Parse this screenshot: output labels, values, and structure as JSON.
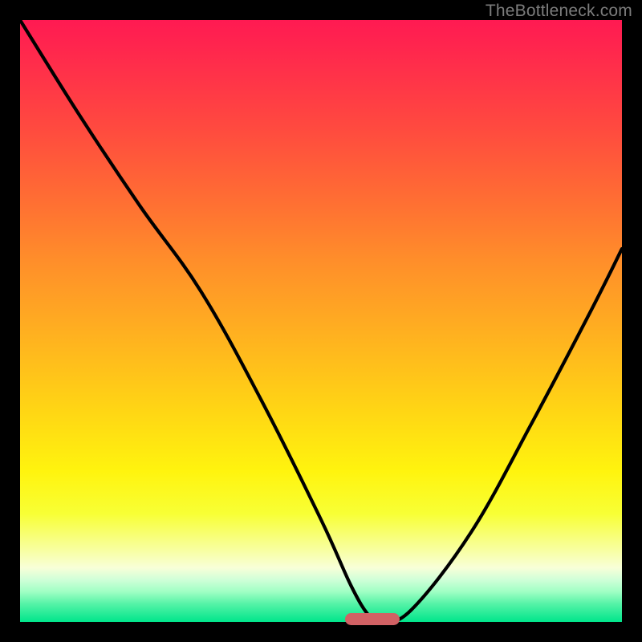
{
  "attribution": "TheBottleneck.com",
  "chart_data": {
    "type": "line",
    "title": "",
    "xlabel": "",
    "ylabel": "",
    "xlim": [
      0,
      100
    ],
    "ylim": [
      0,
      100
    ],
    "series": [
      {
        "name": "bottleneck-curve",
        "x": [
          0,
          10,
          20,
          30,
          40,
          50,
          55,
          58,
          60,
          65,
          75,
          85,
          95,
          100
        ],
        "values": [
          100,
          84,
          69,
          55,
          37,
          17,
          6,
          1,
          0,
          2,
          15,
          33,
          52,
          62
        ]
      }
    ],
    "minimum_region": {
      "x_start": 54,
      "x_end": 63,
      "y": 0
    },
    "gradient_stops": [
      {
        "pos": 0,
        "color": "#ff1a52"
      },
      {
        "pos": 18,
        "color": "#ff4a3f"
      },
      {
        "pos": 40,
        "color": "#ff8e2a"
      },
      {
        "pos": 64,
        "color": "#ffd315"
      },
      {
        "pos": 82,
        "color": "#f8ff35"
      },
      {
        "pos": 93,
        "color": "#cfffd8"
      },
      {
        "pos": 100,
        "color": "#00e58b"
      }
    ]
  },
  "colors": {
    "frame": "#000000",
    "curve": "#000000",
    "marker": "#d16164",
    "attribution": "#7c7c7c"
  }
}
